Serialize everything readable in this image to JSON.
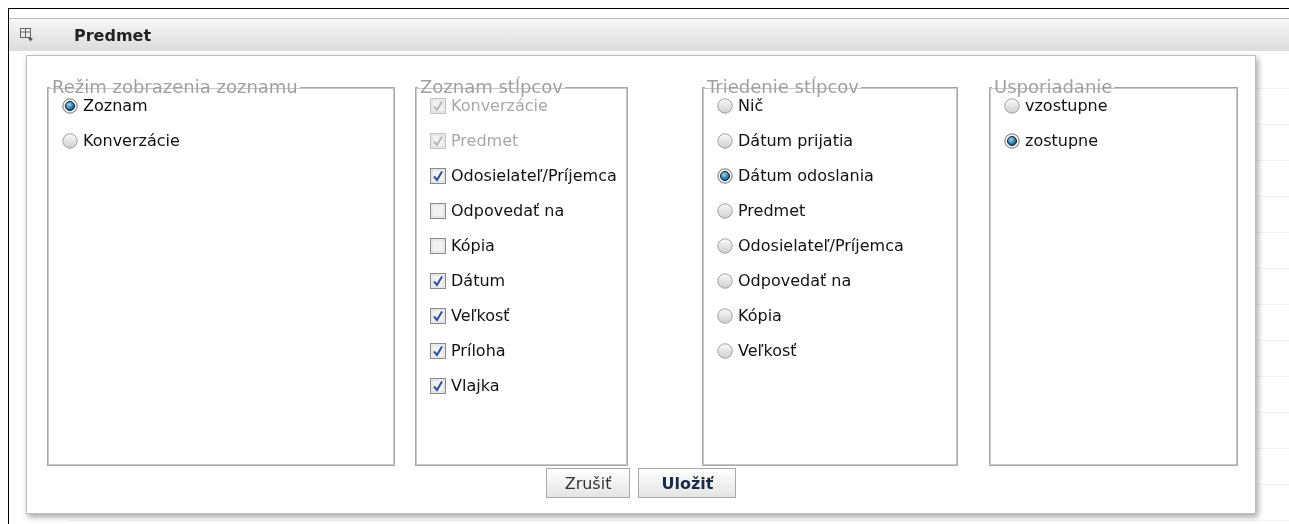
{
  "header": {
    "title": "Predmet"
  },
  "dialog": {
    "groups": [
      {
        "legend": "Režim zobrazenia zoznamu",
        "kind": "radio",
        "options": [
          {
            "label": "Zoznam",
            "selected": true
          },
          {
            "label": "Konverzácie",
            "selected": false
          }
        ]
      },
      {
        "legend": "Zoznam stĺpcov",
        "kind": "checkbox",
        "options": [
          {
            "label": "Konverzácie",
            "checked": true,
            "disabled": true
          },
          {
            "label": "Predmet",
            "checked": true,
            "disabled": true
          },
          {
            "label": "Odosielateľ/Príjemca",
            "checked": true,
            "disabled": false
          },
          {
            "label": "Odpovedať na",
            "checked": false,
            "disabled": false
          },
          {
            "label": "Kópia",
            "checked": false,
            "disabled": false
          },
          {
            "label": "Dátum",
            "checked": true,
            "disabled": false
          },
          {
            "label": "Veľkosť",
            "checked": true,
            "disabled": false
          },
          {
            "label": "Príloha",
            "checked": true,
            "disabled": false
          },
          {
            "label": "Vlajka",
            "checked": true,
            "disabled": false
          }
        ]
      },
      {
        "legend": "Triedenie stĺpcov",
        "kind": "radio",
        "options": [
          {
            "label": "Nič",
            "selected": false
          },
          {
            "label": "Dátum prijatia",
            "selected": false
          },
          {
            "label": "Dátum odoslania",
            "selected": true
          },
          {
            "label": "Predmet",
            "selected": false
          },
          {
            "label": "Odosielateľ/Príjemca",
            "selected": false
          },
          {
            "label": "Odpovedať na",
            "selected": false
          },
          {
            "label": "Kópia",
            "selected": false
          },
          {
            "label": "Veľkosť",
            "selected": false
          }
        ]
      },
      {
        "legend": "Usporiadanie",
        "kind": "radio",
        "options": [
          {
            "label": "vzostupne",
            "selected": false
          },
          {
            "label": "zostupne",
            "selected": true
          }
        ]
      }
    ],
    "buttons": [
      {
        "label": "Zrušiť",
        "primary": false
      },
      {
        "label": "Uložiť",
        "primary": true
      }
    ]
  }
}
